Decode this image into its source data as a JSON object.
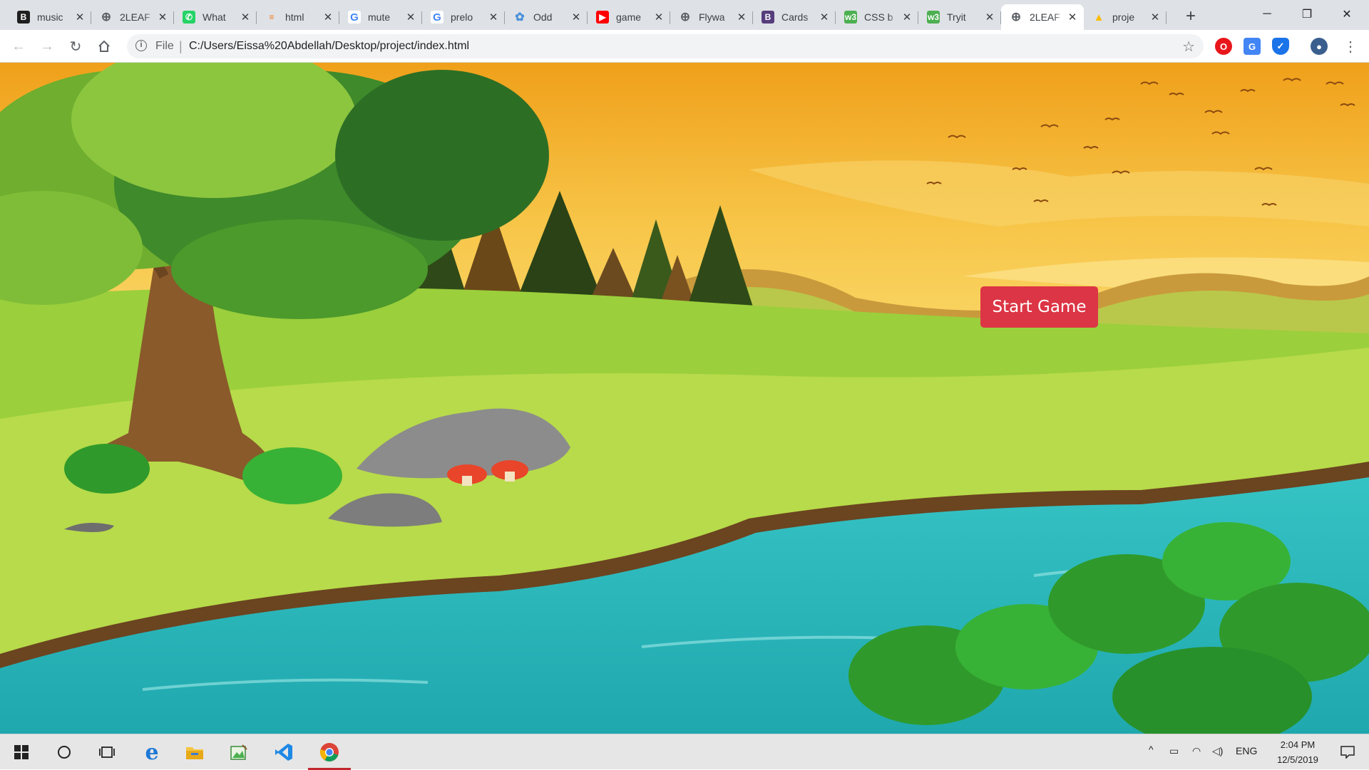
{
  "browser": {
    "tabs": [
      {
        "title": "music",
        "favicon": "bootstrap-icon",
        "favicon_color": "#1f1f1f",
        "favicon_glyph": "B"
      },
      {
        "title": "2LEAF",
        "favicon": "globe-icon",
        "favicon_color": "#5f6368",
        "favicon_glyph": "⊕"
      },
      {
        "title": "What",
        "favicon": "whatsapp-icon",
        "favicon_color": "#25d366",
        "favicon_glyph": "✆"
      },
      {
        "title": "html",
        "favicon": "stackoverflow-icon",
        "favicon_color": "#f48024",
        "favicon_glyph": "≡"
      },
      {
        "title": "mute",
        "favicon": "google-icon",
        "favicon_color": "#4285f4",
        "favicon_glyph": "G"
      },
      {
        "title": "prelo",
        "favicon": "google-icon",
        "favicon_color": "#4285f4",
        "favicon_glyph": "G"
      },
      {
        "title": "Odd",
        "favicon": "gear-icon",
        "favicon_color": "#4a90d9",
        "favicon_glyph": "✿"
      },
      {
        "title": "game",
        "favicon": "youtube-icon",
        "favicon_color": "#ff0000",
        "favicon_glyph": "▶"
      },
      {
        "title": "Flywa",
        "favicon": "globe-icon",
        "favicon_color": "#5f6368",
        "favicon_glyph": "⊕"
      },
      {
        "title": "Cards",
        "favicon": "bootstrap-icon",
        "favicon_color": "#563d7c",
        "favicon_glyph": "B"
      },
      {
        "title": "CSS b",
        "favicon": "w3schools-icon",
        "favicon_color": "#4caf50",
        "favicon_glyph": "w3"
      },
      {
        "title": "Tryit",
        "favicon": "w3schools-icon",
        "favicon_color": "#4caf50",
        "favicon_glyph": "w3"
      },
      {
        "title": "2LEAF",
        "favicon": "globe-icon",
        "favicon_color": "#5f6368",
        "favicon_glyph": "⊕",
        "active": true
      },
      {
        "title": "proje",
        "favicon": "google-drive-icon",
        "favicon_color": "#fbbc04",
        "favicon_glyph": "▲"
      }
    ],
    "new_tab": "+",
    "window_controls": {
      "minimize": "─",
      "restore": "❐",
      "close": "✕"
    },
    "address": {
      "scheme": "File",
      "url": "C:/Users/Eissa%20Abdellah/Desktop/project/index.html"
    }
  },
  "page": {
    "start_button": "Start Game",
    "colors": {
      "button": "#dc3545",
      "sky_top": "#f2a51c",
      "sky_bottom": "#fbe27a",
      "river": "#2bb5b8",
      "grass": "#9bcf3c"
    }
  },
  "taskbar": {
    "tray": {
      "language": "ENG"
    },
    "clock": {
      "time": "2:04 PM",
      "date": "12/5/2019"
    },
    "apps": [
      "windows-start-icon",
      "cortana-search-icon",
      "task-view-icon",
      "edge-icon",
      "file-explorer-icon",
      "image-app-icon",
      "vscode-icon",
      "chrome-icon"
    ]
  }
}
